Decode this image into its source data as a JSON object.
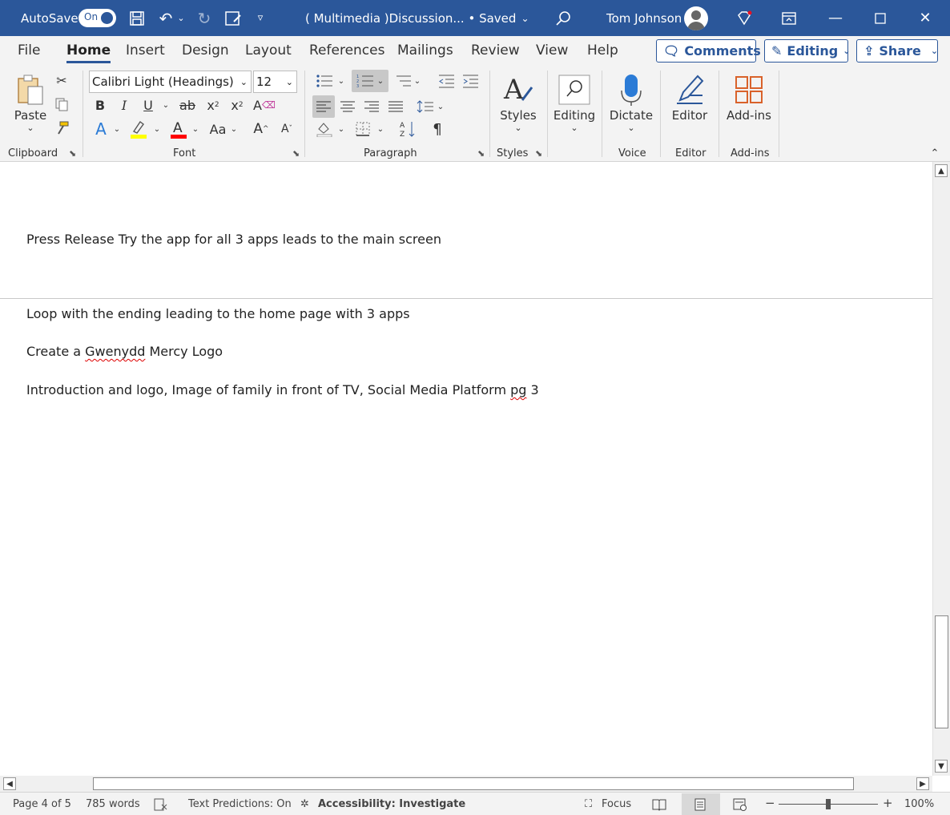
{
  "titlebar": {
    "autosave_label": "AutoSave",
    "autosave_state": "On",
    "doc_title": "( Multimedia )Discussion...  • Saved",
    "user_name": "Tom Johnson"
  },
  "menu": {
    "tabs": [
      "File",
      "Home",
      "Insert",
      "Design",
      "Layout",
      "References",
      "Mailings",
      "Review",
      "View",
      "Help"
    ],
    "active_tab": "Home",
    "comments_label": "Comments",
    "editing_label": "Editing",
    "share_label": "Share"
  },
  "ribbon": {
    "paste_label": "Paste",
    "clipboard_label": "Clipboard",
    "font_name": "Calibri Light (Headings)",
    "font_size": "12",
    "font_label": "Font",
    "paragraph_label": "Paragraph",
    "styles_label": "Styles",
    "styles_group_label": "Styles",
    "editing_label": "Editing",
    "dictate_label": "Dictate",
    "voice_label": "Voice",
    "editor_label": "Editor",
    "editor_group_label": "Editor",
    "addins_label": "Add-ins",
    "addins_group_label": "Add-ins"
  },
  "document": {
    "lines": [
      "Press Release Try the app for all 3 apps leads to the main screen",
      "Loop with the ending leading to the home page with 3 apps",
      "Create a ",
      "Gwenydd",
      " Mercy Logo",
      "Introduction and logo, Image of family in front of TV, Social Media Platform ",
      "pg",
      " 3"
    ]
  },
  "status": {
    "page": "Page 4 of 5",
    "words": "785 words",
    "text_predictions": "Text Predictions: On",
    "accessibility": "Accessibility: Investigate",
    "focus": "Focus",
    "zoom": "100%",
    "zoom_minus": "−",
    "zoom_plus": "+"
  },
  "colors": {
    "brand": "#2b579a",
    "highlight_yellow": "#ffff00",
    "font_red": "#ff0000",
    "spellcheck": "#dd0000"
  }
}
